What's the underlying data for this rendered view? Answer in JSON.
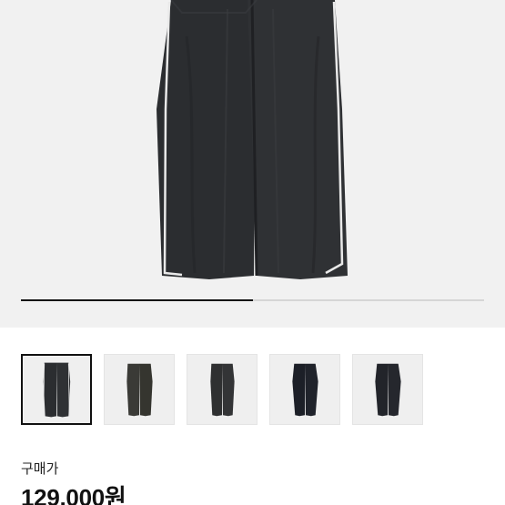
{
  "product": {
    "image_icon": "pants-image",
    "gallery": {
      "progress_fraction": 0.5,
      "thumbnail_count": 5,
      "selected_index": 0
    },
    "price_label": "구매가",
    "price_value": "129,000원"
  },
  "colors": {
    "hero_bg": "#f1f1f1",
    "pants": "#2b2d30",
    "piping": "#e9e9e9",
    "progress_active": "#111111",
    "progress_track": "#d6d6d6"
  }
}
